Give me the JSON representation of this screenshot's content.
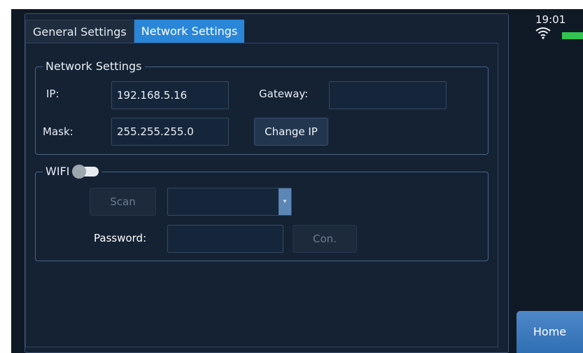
{
  "tabs": [
    {
      "label": "General Settings",
      "active": false
    },
    {
      "label": "Network Settings",
      "active": true
    }
  ],
  "network": {
    "legend": "Network Settings",
    "ip_label": "IP:",
    "ip_value": "192.168.5.16",
    "gateway_label": "Gateway:",
    "gateway_value": "",
    "mask_label": "Mask:",
    "mask_value": "255.255.255.0",
    "change_ip_label": "Change IP"
  },
  "wifi": {
    "legend": "WIFI",
    "enabled": false,
    "scan_label": "Scan",
    "network_select_value": "",
    "password_label": "Password:",
    "password_value": "",
    "connect_label": "Con."
  },
  "status": {
    "time": "19:01",
    "wifi_icon": "wifi-icon",
    "battery_icon": "battery-icon"
  },
  "home_label": "Home",
  "colors": {
    "active_tab": "#2a86d8",
    "home_button": "#3d7cc0",
    "battery": "#31c451"
  }
}
